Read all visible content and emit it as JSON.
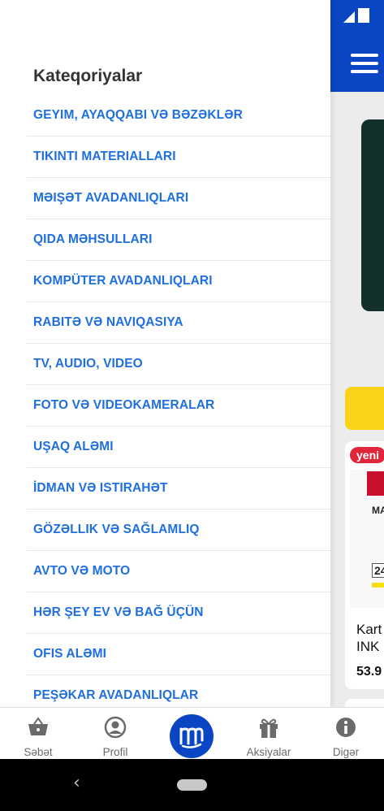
{
  "drawer": {
    "title": "Kateqoriyalar",
    "categories": [
      "GEYIM, AYAQQABI VƏ BƏZƏKLƏR",
      "TIKINTI MATERIALLARI",
      "MƏIŞƏT AVADANLIQLARI",
      "QIDA MƏHSULLARI",
      "KOMPÜTER AVADANLIQLARI",
      "RABITƏ VƏ NAVIQASIYA",
      "TV, AUDIO, VIDEO",
      "FOTO VƏ VIDEOKAMERALAR",
      "UŞAQ ALƏMI",
      "İDMAN VƏ ISTIRAHƏT",
      "GÖZƏLLIK VƏ SAĞLAMLIQ",
      "AVTO VƏ MOTO",
      "HƏR ŞEY EV VƏ BAĞ ÜÇÜN",
      "OFIS ALƏMI",
      "PEŞƏKAR AVADANLIQLAR"
    ]
  },
  "background": {
    "new_badge": "yeni",
    "product_title_partial": "Kart INK",
    "product_price_partial": "53.9",
    "box_text": "MA",
    "box_number": "24"
  },
  "bottom_nav": {
    "cart": "Səbət",
    "profile": "Profil",
    "promotions": "Aksiyalar",
    "other": "Digər"
  },
  "colors": {
    "brand_blue": "#0a46c4",
    "link_blue": "#1f6fe0",
    "accent_yellow": "#f9d21a",
    "badge_red": "#e0263a"
  },
  "icons": [
    "signal-icon",
    "hamburger-menu-icon",
    "basket-icon",
    "user-icon",
    "brand-logo-icon",
    "gift-icon",
    "info-icon",
    "back-icon",
    "home-pill-icon"
  ]
}
